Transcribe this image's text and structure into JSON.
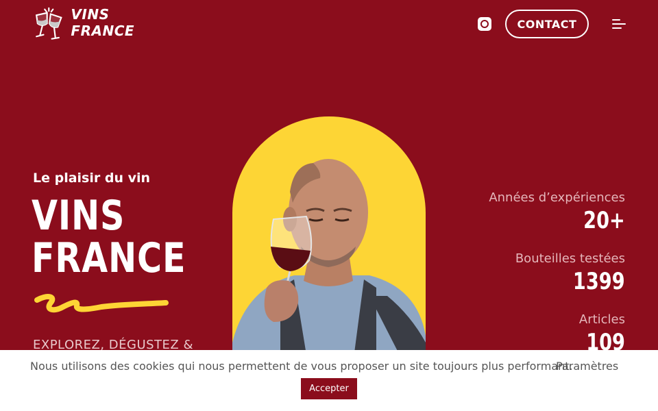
{
  "header": {
    "logo_text": "VINS FRANCE",
    "logo_icon": "wine-glasses-cheers-icon",
    "instagram_icon": "instagram-icon",
    "contact_label": "CONTACT",
    "menu_icon": "hamburger-menu-icon"
  },
  "hero": {
    "tagline": "Le plaisir du vin",
    "title_line1": "VINS",
    "title_line2": "FRANCE",
    "subline": "EXPLOREZ, DÉGUSTEZ &",
    "image_alt": "sommelier-tasting-red-wine"
  },
  "stats": [
    {
      "label": "Années d’expériences",
      "value": "20+"
    },
    {
      "label": "Bouteilles testées",
      "value": "1399"
    },
    {
      "label": "Articles",
      "value": "109"
    }
  ],
  "cookie": {
    "message": "Nous utilisons des cookies qui nous permettent de vous proposer un site toujours plus performant.",
    "settings_label": "Paramètres",
    "accept_label": "Accepter"
  },
  "colors": {
    "background": "#8b0d1c",
    "accent": "#fdd535",
    "text": "#ffffff",
    "cookie_bg": "#ffffff"
  }
}
